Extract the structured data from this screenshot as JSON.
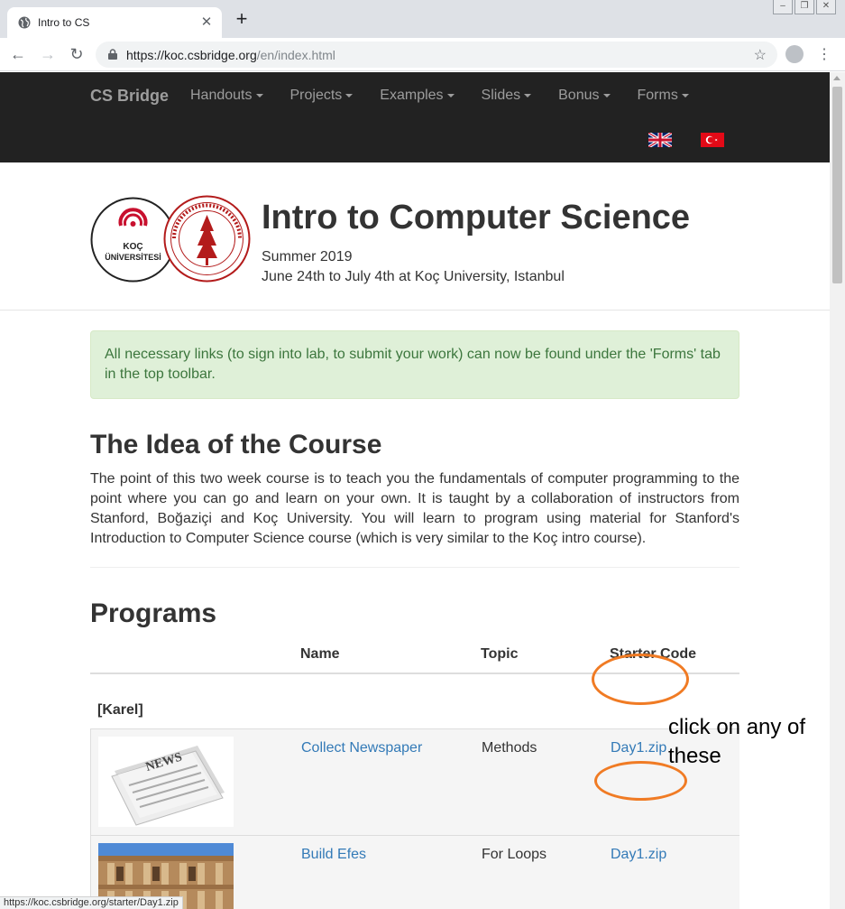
{
  "browser": {
    "tab_title": "Intro to CS",
    "url_host": "https://koc.csbridge.org",
    "url_path": "/en/index.html",
    "status_url": "https://koc.csbridge.org/starter/Day1.zip"
  },
  "navbar": {
    "brand": "CS Bridge",
    "items": [
      {
        "label": "Handouts"
      },
      {
        "label": "Projects"
      },
      {
        "label": "Examples"
      },
      {
        "label": "Slides"
      },
      {
        "label": "Bonus"
      },
      {
        "label": "Forms"
      }
    ],
    "flags": [
      "uk-flag",
      "turkey-flag"
    ]
  },
  "header": {
    "title": "Intro to Computer Science",
    "subtitle": "Summer 2019",
    "dates": "June 24th to July 4th at Koç University, Istanbul",
    "koc_logo_text_1": "KOÇ",
    "koc_logo_text_2": "ÜNİVERSİTESİ"
  },
  "alert": {
    "text": "All necessary links (to sign into lab, to submit your work) can now be found under the 'Forms' tab in the top toolbar."
  },
  "idea": {
    "heading": "The Idea of the Course",
    "paragraph": "The point of this two week course is to teach you the fundamentals of computer programming to the point where you can go and learn on your own. It is taught by a collaboration of instructors from Stanford, Boğaziçi and Koç University. You will learn to program using material for Stanford's Introduction to Computer Science course (which is very similar to the Koç intro course)."
  },
  "programs": {
    "heading": "Programs",
    "columns": {
      "name": "Name",
      "topic": "Topic",
      "starter": "Starter Code"
    },
    "group": "[Karel]",
    "rows": [
      {
        "name": "Collect Newspaper",
        "topic": "Methods",
        "starter": "Day1.zip",
        "thumb_text": "NEWS"
      },
      {
        "name": "Build Efes",
        "topic": "For Loops",
        "starter": "Day1.zip"
      }
    ]
  },
  "annotation": {
    "text": "click on any of these",
    "color": "#f07b24"
  },
  "colors": {
    "navbar_bg": "#222222",
    "navbar_text": "#9d9d9d",
    "link": "#337ab7",
    "alert_bg": "#dff0d8",
    "alert_text": "#3c763d",
    "turkey_red": "#e30a17",
    "stanford_red": "#b31b1b",
    "koc_red": "#c8102e"
  }
}
